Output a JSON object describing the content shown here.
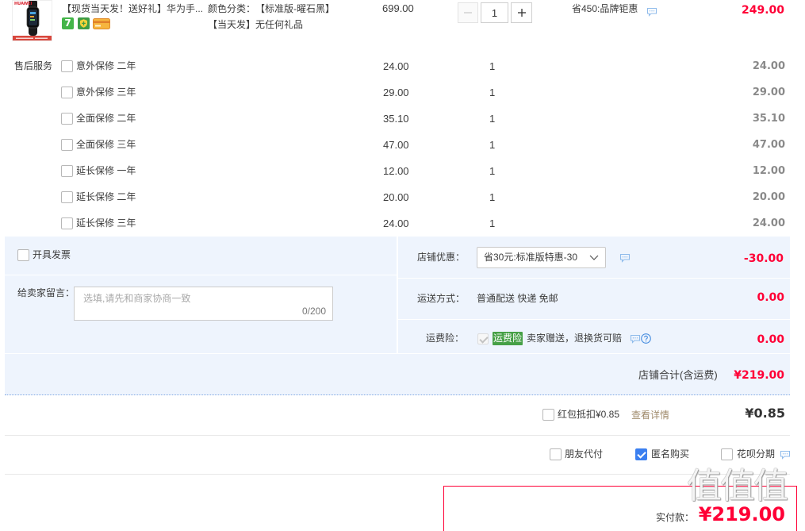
{
  "colors": {
    "price_red": "#ff0036",
    "text": "#3c3c3c",
    "section_bg": "#eef4fd",
    "section_border": "#7fa9e3",
    "check_blue": "#3b7ff0",
    "badge_green": "#46a046",
    "chat_icon": "#8fbbeb",
    "link": "#a08b6c"
  },
  "icons": {
    "product_badges": [
      "seven-day-return-icon",
      "guarantee-icon",
      "card-icon"
    ],
    "chat": "chat-bubble-icon",
    "help": "question-circle-icon",
    "dropdown": "chevron-down-icon",
    "stepper": [
      "minus-icon",
      "plus-icon"
    ],
    "checkbox": "check-icon"
  },
  "product": {
    "brand_logo": "HUAWEI",
    "title": "【现货当天发！送好礼】华为手...",
    "badge_seven": "7",
    "sku_label": "颜色分类：",
    "sku_value": "【标准版-曜石黑】",
    "gift": "【当天发】无任何礼品",
    "price": "699.00",
    "quantity": "1",
    "promo": "省450:品牌钜惠",
    "subtotal": "249.00"
  },
  "services": {
    "label": "售后服务",
    "items": [
      {
        "name": "意外保修 二年",
        "price": "24.00",
        "qty": "1",
        "subtotal": "24.00",
        "checked": false
      },
      {
        "name": "意外保修 三年",
        "price": "29.00",
        "qty": "1",
        "subtotal": "29.00",
        "checked": false
      },
      {
        "name": "全面保修 二年",
        "price": "35.10",
        "qty": "1",
        "subtotal": "35.10",
        "checked": false
      },
      {
        "name": "全面保修 三年",
        "price": "47.00",
        "qty": "1",
        "subtotal": "47.00",
        "checked": false
      },
      {
        "name": "延长保修 一年",
        "price": "12.00",
        "qty": "1",
        "subtotal": "12.00",
        "checked": false
      },
      {
        "name": "延长保修 二年",
        "price": "20.00",
        "qty": "1",
        "subtotal": "20.00",
        "checked": false
      },
      {
        "name": "延长保修 三年",
        "price": "24.00",
        "qty": "1",
        "subtotal": "24.00",
        "checked": false
      }
    ]
  },
  "invoice": {
    "label": "开具发票",
    "checked": false
  },
  "message": {
    "label": "给卖家留言：",
    "placeholder": "选填,请先和商家协商一致",
    "value": "",
    "counter": "0/200"
  },
  "store_discount": {
    "label": "店铺优惠：",
    "selected": "省30元:标准版特惠-30",
    "amount": "-30.00"
  },
  "shipping": {
    "label": "运送方式：",
    "method": "普通配送 快递 免邮",
    "amount": "0.00"
  },
  "shipping_insurance": {
    "label": "运费险：",
    "checked": true,
    "disabled": true,
    "badge": "运费险",
    "description": "卖家赠送，退换货可赔",
    "amount": "0.00"
  },
  "store_total": {
    "label": "店铺合计(含运费)",
    "amount": "¥219.00"
  },
  "red_packet": {
    "label": "红包抵扣¥0.85",
    "link": "查看详情",
    "amount": "¥0.85",
    "checked": false
  },
  "order_options": [
    {
      "label": "朋友代付",
      "checked": false
    },
    {
      "label": "匿名购买",
      "checked": true
    },
    {
      "label": "花呗分期",
      "checked": false
    }
  ],
  "payment": {
    "label": "实付款：",
    "amount": "¥219.00"
  },
  "watermark": {
    "glyphs": "值值值"
  }
}
